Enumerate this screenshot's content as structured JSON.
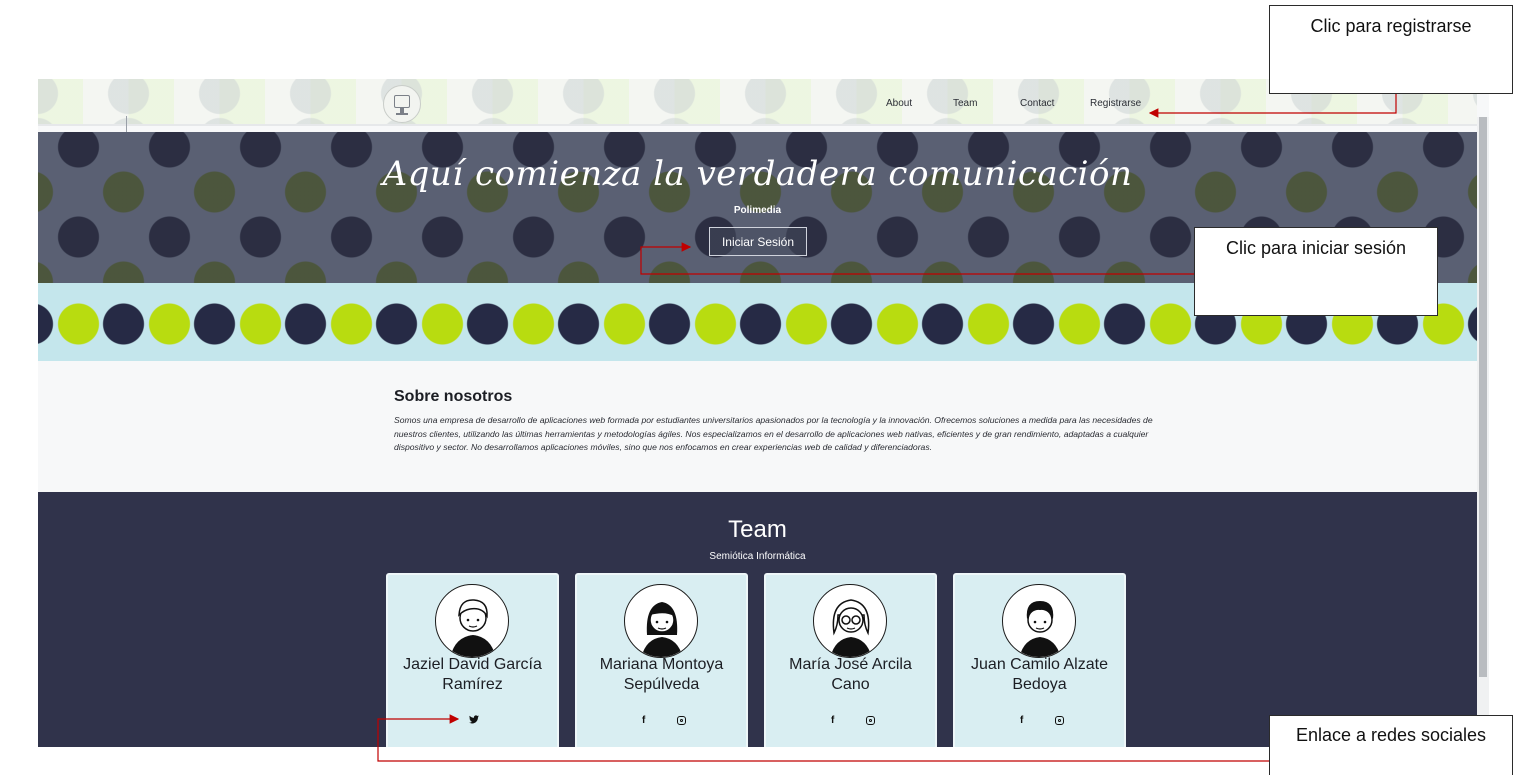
{
  "nav": {
    "links": [
      "About",
      "Team",
      "Contact",
      "Registrarse"
    ]
  },
  "hero": {
    "title": "Aquí comienza la verdadera comunicación",
    "subtitle": "Polimedia",
    "login_label": "Iniciar Sesión"
  },
  "about": {
    "title": "Sobre nosotros",
    "text": "Somos una empresa de desarrollo de aplicaciones web formada por estudiantes universitarios apasionados por la tecnología y la innovación. Ofrecemos soluciones a medida para las necesidades de nuestros clientes, utilizando las últimas herramientas y metodologías ágiles. Nos especializamos en el desarrollo de aplicaciones web nativas, eficientes y de gran rendimiento, adaptadas a cualquier dispositivo y sector. No desarrollamos aplicaciones móviles, sino que nos enfocamos en crear experiencias web de calidad y diferenciadoras."
  },
  "team": {
    "title": "Team",
    "subtitle": "Semiótica Informática",
    "members": [
      {
        "name_line1": "Jaziel David García",
        "name_line2": "Ramírez",
        "socials": [
          "twitter-icon"
        ]
      },
      {
        "name_line1": "Mariana Montoya",
        "name_line2": "Sepúlveda",
        "socials": [
          "facebook-icon",
          "instagram-icon"
        ]
      },
      {
        "name_line1": "María José Arcila",
        "name_line2": "Cano",
        "socials": [
          "facebook-icon",
          "instagram-icon"
        ]
      },
      {
        "name_line1": "Juan Camilo Alzate",
        "name_line2": "Bedoya",
        "socials": [
          "facebook-icon",
          "instagram-icon"
        ]
      }
    ]
  },
  "annotations": {
    "register": "Clic para registrarse",
    "login": "Clic para iniciar sesión",
    "social": "Enlace a redes sociales"
  },
  "colors": {
    "annotation_arrow": "#c00000",
    "team_background": "#30334b",
    "card_background": "#d9eef2",
    "accent_green": "#b8dc10"
  }
}
